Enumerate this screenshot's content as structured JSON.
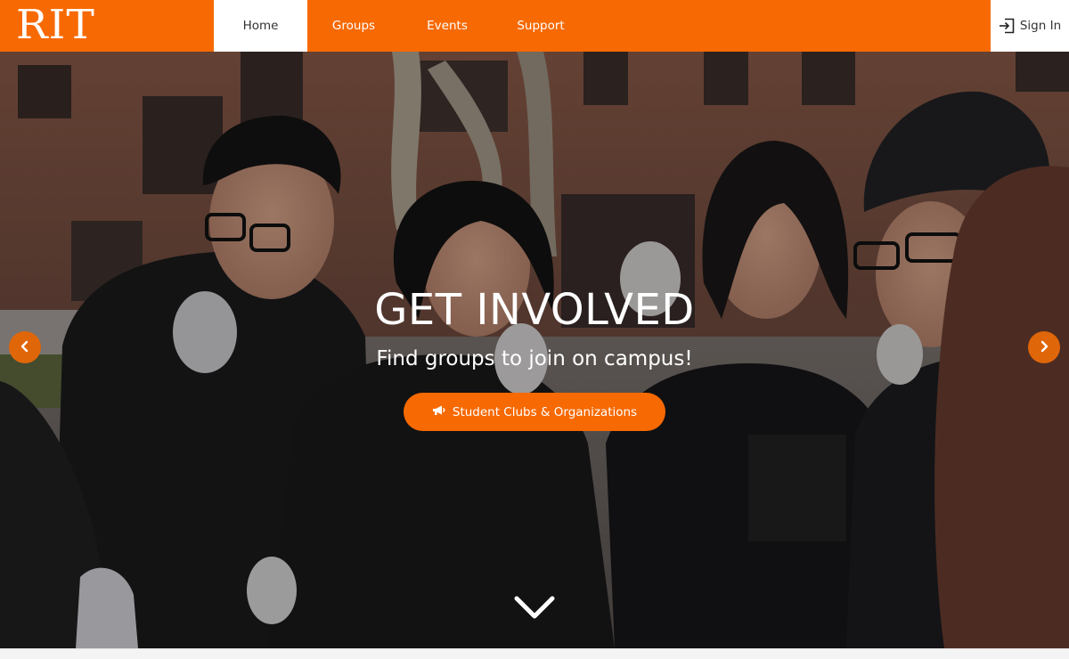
{
  "brand": {
    "logo_text": "RIT"
  },
  "nav": {
    "items": [
      {
        "label": "Home",
        "active": true
      },
      {
        "label": "Groups",
        "active": false
      },
      {
        "label": "Events",
        "active": false
      },
      {
        "label": "Support",
        "active": false
      }
    ],
    "signin_label": "Sign In",
    "signin_icon": "sign-in-icon"
  },
  "hero": {
    "title": "GET INVOLVED",
    "subtitle": "Find groups to join on campus!",
    "cta_label": "Student Clubs & Organizations",
    "cta_icon": "megaphone-icon",
    "prev_icon": "chevron-left-icon",
    "next_icon": "chevron-right-icon",
    "scroll_icon": "chevron-down-icon"
  },
  "colors": {
    "brand_orange": "#f76902",
    "arrow_orange": "#e0660a",
    "white": "#ffffff",
    "text_dark": "#333333"
  }
}
